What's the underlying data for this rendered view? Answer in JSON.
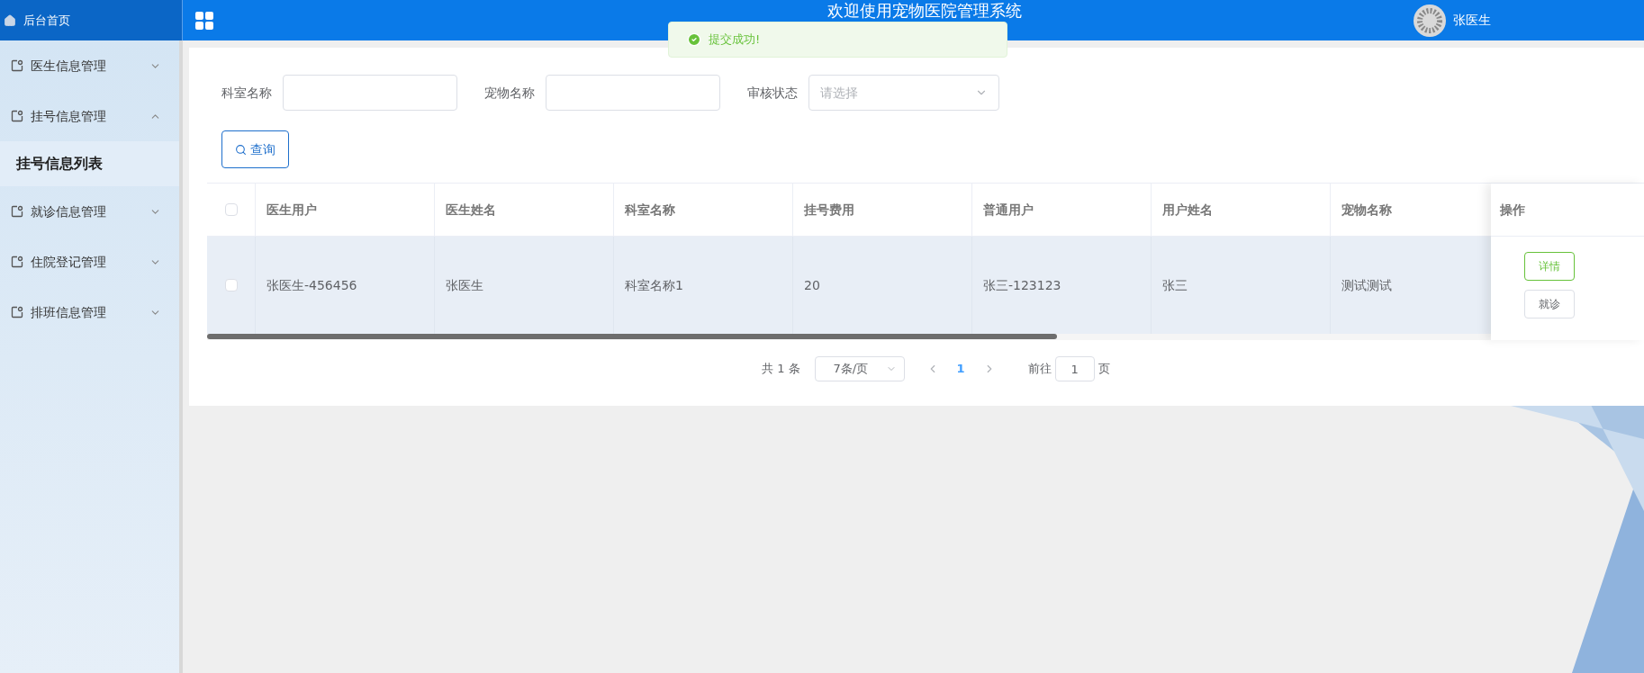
{
  "header": {
    "home": "后台首页",
    "title": "欢迎使用宠物医院管理系统",
    "user": "张医生"
  },
  "toast": {
    "message": "提交成功!"
  },
  "sidebar": {
    "items": [
      {
        "label": "医生信息管理",
        "expanded": false
      },
      {
        "label": "挂号信息管理",
        "expanded": true,
        "children": [
          {
            "label": "挂号信息列表",
            "selected": true
          }
        ]
      },
      {
        "label": "就诊信息管理",
        "expanded": false
      },
      {
        "label": "住院登记管理",
        "expanded": false
      },
      {
        "label": "排班信息管理",
        "expanded": false
      }
    ]
  },
  "filters": [
    {
      "kind": "input",
      "label": "科室名称"
    },
    {
      "kind": "input",
      "label": "宠物名称"
    },
    {
      "kind": "select",
      "label": "审核状态",
      "placeholder": "请选择"
    }
  ],
  "search_button": "查询",
  "table": {
    "columns": [
      "医生用户",
      "医生姓名",
      "科室名称",
      "挂号费用",
      "普通用户",
      "用户姓名",
      "宠物名称"
    ],
    "action_column": "操作",
    "select_all_checked": false,
    "rows": [
      {
        "checked": false,
        "cells": [
          "张医生-456456",
          "张医生",
          "科室名称1",
          "20",
          "张三-123123",
          "张三",
          "测试测试"
        ],
        "actions": [
          {
            "kind": "primary",
            "label": "详情"
          },
          {
            "kind": "default",
            "label": "就诊"
          }
        ]
      }
    ]
  },
  "pagination": {
    "total": "共 1 条",
    "page_size": "7条/页",
    "pages": [
      {
        "label": "1",
        "selected": true
      }
    ],
    "goto_label": "前往",
    "goto_value": "1",
    "page_suffix": "页"
  }
}
